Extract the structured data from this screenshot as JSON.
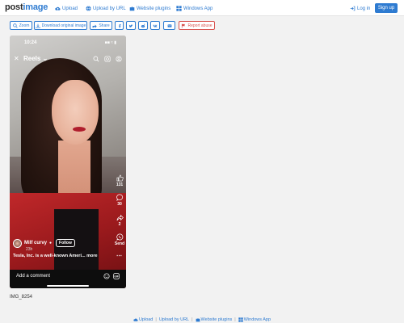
{
  "site": {
    "logo_main": "post",
    "logo_accent": "image"
  },
  "nav": {
    "upload": "Upload",
    "upload_by_url": "Upload by URL",
    "website_plugins": "Website plugins",
    "windows_app": "Windows App",
    "login": "Log in",
    "signup": "Sign up"
  },
  "toolbar": {
    "zoom": "Zoom",
    "download": "Download original image",
    "share": "Share",
    "report": "Report abuse"
  },
  "phone": {
    "status_time": "10:24",
    "status_right": "■■ ≈ ▮",
    "screen_title": "Reels",
    "likes": "131",
    "comments": "30",
    "shares": "2",
    "send": "Send",
    "username": "Milf curvy",
    "follow": "Follow",
    "time_ago": "23h",
    "caption": "Tesla, Inc. is a well-known Ameri... more",
    "comment_placeholder": "Add a comment"
  },
  "image": {
    "file_name": "IMG_8254"
  },
  "footer": {
    "upload": "Upload",
    "upload_by_url": "Upload by URL",
    "website_plugins": "Website plugins",
    "windows_app": "Windows App",
    "separator": "|"
  },
  "colors": {
    "accent": "#2e7bd1",
    "report": "#d9534f",
    "page_bg": "#f2f2f2"
  }
}
